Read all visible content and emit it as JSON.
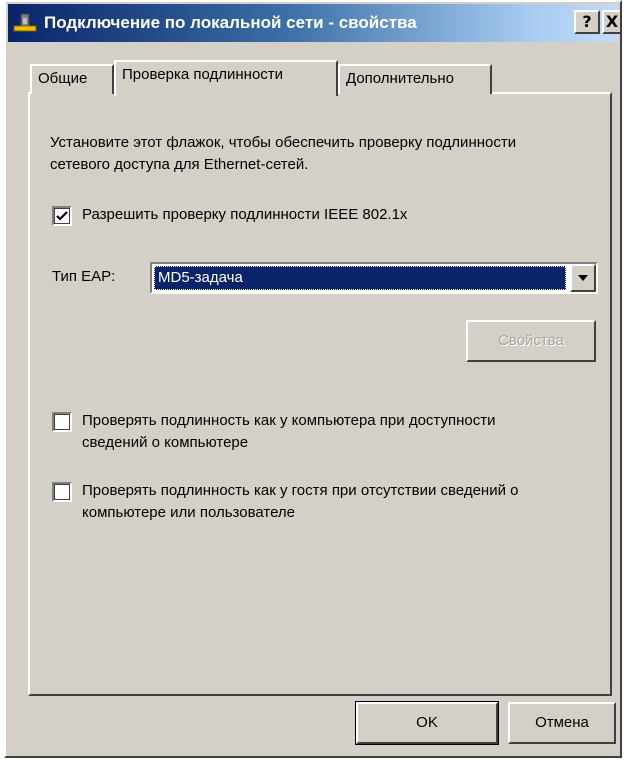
{
  "window": {
    "title": "Подключение по локальной сети - свойства",
    "help_button": "?",
    "close_button": "X"
  },
  "tabs": [
    {
      "label": "Общие",
      "active": false
    },
    {
      "label": "Проверка подлинности",
      "active": true
    },
    {
      "label": "Дополнительно",
      "active": false
    }
  ],
  "auth": {
    "description": "Установите этот флажок, чтобы обеспечить проверку подлинности сетевого доступа для Ethernet-сетей.",
    "enable_checkbox": {
      "label": "Разрешить проверку подлинности IEEE 802.1x",
      "checked": true
    },
    "eap_label": "Тип EAP:",
    "eap_selected": "MD5-задача",
    "properties_button": "Свойства",
    "computer_auth_checkbox": {
      "label": "Проверять подлинность как у компьютера при доступности сведений о компьютере",
      "checked": false
    },
    "guest_auth_checkbox": {
      "label": "Проверять подлинность как у гостя при отсутствии сведений о компьютере или пользователе",
      "checked": false
    }
  },
  "footer": {
    "ok": "OK",
    "cancel": "Отмена"
  },
  "colors": {
    "titlebar_start": "#0a246a",
    "titlebar_end": "#c4dcf4",
    "face": "#d4d0c8",
    "selection": "#0a246a"
  },
  "icons": {
    "app": "network-connection-icon",
    "check": "checkmark-icon",
    "dropdown": "chevron-down-icon"
  }
}
